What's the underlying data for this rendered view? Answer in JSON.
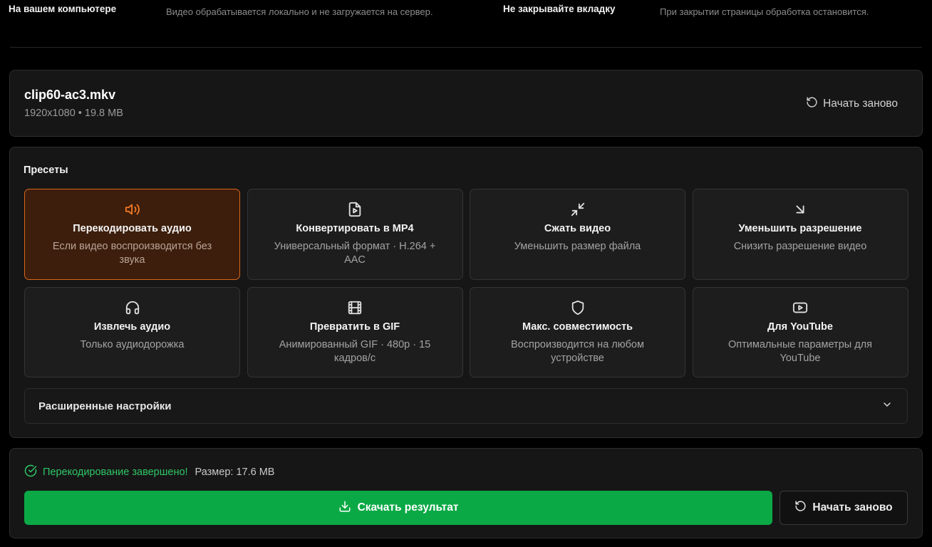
{
  "info": {
    "items": [
      {
        "title": "На вашем компьютере",
        "desc": "Видео обрабатывается локально и не загружается на сервер."
      },
      {
        "title": "Не закрывайте вкладку",
        "desc": "При закрытии страницы обработка остановится."
      }
    ]
  },
  "file": {
    "name": "clip60-ac3.mkv",
    "meta": "1920x1080 • 19.8 MB",
    "restart_label": "Начать заново"
  },
  "presets": {
    "title": "Пресеты",
    "items": [
      {
        "icon": "speaker-icon",
        "title": "Перекодировать аудио",
        "desc": "Если видео воспроизводится без звука",
        "active": true
      },
      {
        "icon": "file-video-icon",
        "title": "Конвертировать в MP4",
        "desc": "Универсальный формат · H.264 + AAC",
        "active": false
      },
      {
        "icon": "minimize-arrows-icon",
        "title": "Сжать видео",
        "desc": "Уменьшить размер файла",
        "active": false
      },
      {
        "icon": "arrow-down-right-icon",
        "title": "Уменьшить разрешение",
        "desc": "Снизить разрешение видео",
        "active": false
      },
      {
        "icon": "headphones-icon",
        "title": "Извлечь аудио",
        "desc": "Только аудиодорожка",
        "active": false
      },
      {
        "icon": "film-icon",
        "title": "Превратить в GIF",
        "desc": "Анимированный GIF · 480p · 15 кадров/с",
        "active": false
      },
      {
        "icon": "shield-icon",
        "title": "Макс. совместимость",
        "desc": "Воспроизводится на любом устройстве",
        "active": false
      },
      {
        "icon": "youtube-icon",
        "title": "Для YouTube",
        "desc": "Оптимальные параметры для YouTube",
        "active": false
      }
    ]
  },
  "advanced": {
    "label": "Расширенные настройки"
  },
  "result": {
    "status": "Перекодирование завершено!",
    "size": "Размер: 17.6 MB",
    "download_label": "Скачать результат",
    "restart_label": "Начать заново"
  },
  "colors": {
    "accent_orange": "#f47a26",
    "success_green": "#0ba946",
    "status_green": "#2fc766"
  }
}
